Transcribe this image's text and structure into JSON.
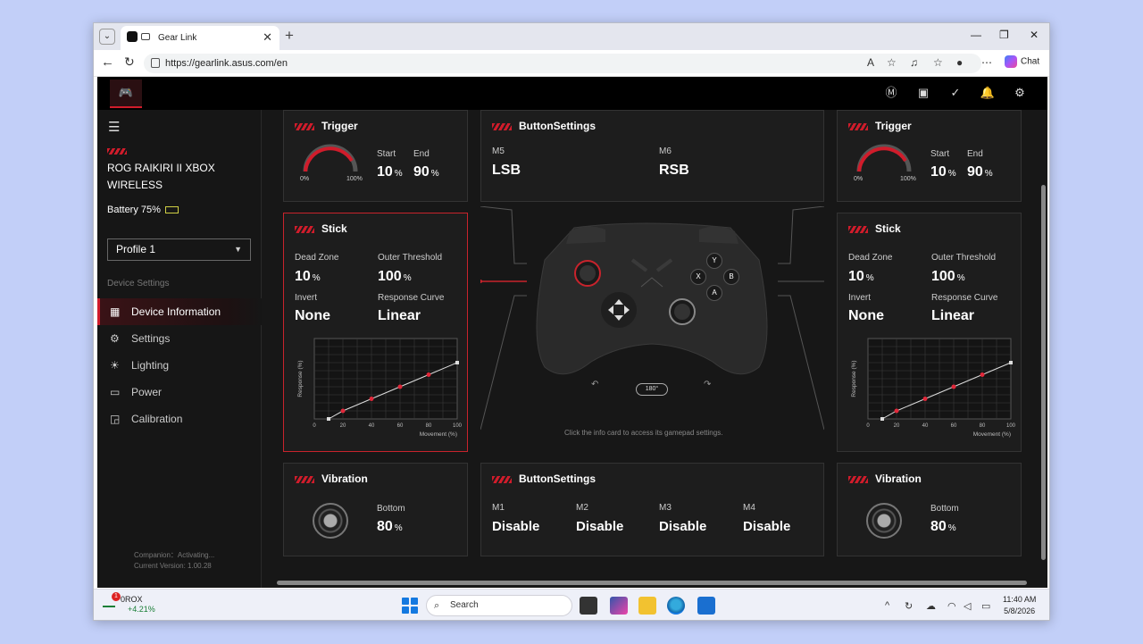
{
  "browser": {
    "tab_title": "Gear Link",
    "url": "https://gearlink.asus.com/en",
    "chat_label": "Chat",
    "minimize": "—",
    "restore": "❐",
    "close": "✕"
  },
  "sidebar": {
    "device_name": "ROG RAIKIRI II XBOX WIRELESS",
    "battery": "Battery 75%",
    "profile": "Profile 1",
    "section_label": "Device Settings",
    "items": [
      {
        "label": "Device Information",
        "icon": "grid-icon"
      },
      {
        "label": "Settings",
        "icon": "gear-icon"
      },
      {
        "label": "Lighting",
        "icon": "sun-icon"
      },
      {
        "label": "Power",
        "icon": "battery-icon"
      },
      {
        "label": "Calibration",
        "icon": "calibration-icon"
      }
    ],
    "companion": "Companion：Activating...",
    "version": "Current Version: 1.00.28"
  },
  "cards": {
    "trigger_left": {
      "title": "Trigger",
      "start_label": "Start",
      "start_value": "10",
      "end_label": "End",
      "end_value": "90",
      "unit": "%",
      "gauge_min": "0%",
      "gauge_max": "100%"
    },
    "trigger_right": {
      "title": "Trigger",
      "start_label": "Start",
      "start_value": "10",
      "end_label": "End",
      "end_value": "90",
      "unit": "%",
      "gauge_min": "0%",
      "gauge_max": "100%"
    },
    "button_top": {
      "title": "ButtonSettings",
      "m5_label": "M5",
      "m5_value": "LSB",
      "m6_label": "M6",
      "m6_value": "RSB"
    },
    "stick_left": {
      "title": "Stick",
      "dead_zone_label": "Dead Zone",
      "dead_zone": "10",
      "outer_label": "Outer Threshold",
      "outer": "100",
      "invert_label": "Invert",
      "invert": "None",
      "curve_label": "Response Curve",
      "curve": "Linear",
      "unit": "%",
      "y_axis": "Response (%)",
      "x_axis": "Movement (%)"
    },
    "stick_right": {
      "title": "Stick",
      "dead_zone_label": "Dead Zone",
      "dead_zone": "10",
      "outer_label": "Outer Threshold",
      "outer": "100",
      "invert_label": "Invert",
      "invert": "None",
      "curve_label": "Response Curve",
      "curve": "Linear",
      "unit": "%",
      "y_axis": "Response (%)",
      "x_axis": "Movement (%)"
    },
    "vibration_left": {
      "title": "Vibration",
      "bottom_label": "Bottom",
      "bottom": "80",
      "unit": "%"
    },
    "vibration_right": {
      "title": "Vibration",
      "bottom_label": "Bottom",
      "bottom": "80",
      "unit": "%"
    },
    "button_bottom": {
      "title": "ButtonSettings",
      "m1_label": "M1",
      "m1": "Disable",
      "m2_label": "M2",
      "m2": "Disable",
      "m3_label": "M3",
      "m3": "Disable",
      "m4_label": "M4",
      "m4": "Disable"
    }
  },
  "curve_ticks": [
    "0",
    "20",
    "40",
    "60",
    "80",
    "100"
  ],
  "curve_points": [
    [
      10,
      0
    ],
    [
      20,
      10
    ],
    [
      40,
      25
    ],
    [
      60,
      40
    ],
    [
      80,
      55
    ],
    [
      100,
      70
    ]
  ],
  "controller": {
    "buttons": [
      "Y",
      "X",
      "B",
      "A"
    ],
    "rotate_label": "180°",
    "hint": "Click the info card to access its gamepad settings."
  },
  "taskbar": {
    "stock_name": "0ROX",
    "stock_change": "+4.21%",
    "stock_badge": "1",
    "search": "Search",
    "time": "11:40 AM",
    "date": "5/8/2026"
  },
  "colors": {
    "accent": "#d01c2b",
    "background": "#171717",
    "card": "#1d1d1d"
  }
}
